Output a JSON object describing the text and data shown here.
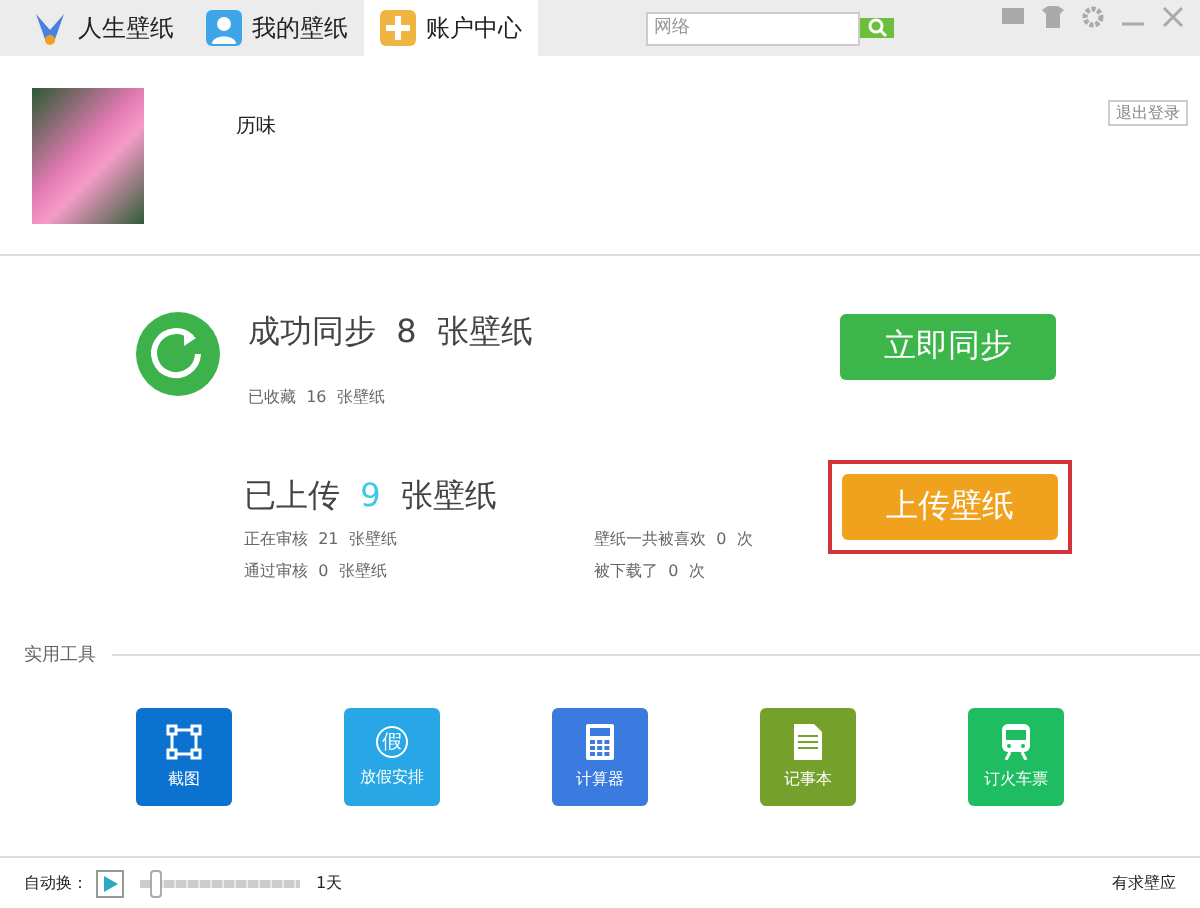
{
  "tabs": [
    {
      "label": "人生壁纸",
      "selected": false
    },
    {
      "label": "我的壁纸",
      "selected": false
    },
    {
      "label": "账户中心",
      "selected": true
    }
  ],
  "search": {
    "placeholder": "网络"
  },
  "profile": {
    "name": "历味",
    "logout": "退出登录"
  },
  "sync": {
    "title": "成功同步",
    "count": "8",
    "unit": "张壁纸",
    "sub_label": "已收藏",
    "sub_count": "16",
    "sub_unit": "张壁纸",
    "button": "立即同步"
  },
  "upload": {
    "title": "已上传",
    "count": "9",
    "unit": "张壁纸",
    "button": "上传壁纸",
    "highlighted": true,
    "stats": [
      {
        "label": "正在审核",
        "value": "21",
        "unit": "张壁纸"
      },
      {
        "label": "壁纸一共被喜欢",
        "value": "0",
        "unit": "次"
      },
      {
        "label": "通过审核",
        "value": "0",
        "unit": "张壁纸"
      },
      {
        "label": "被下载了",
        "value": "0",
        "unit": "次"
      }
    ]
  },
  "tools": {
    "heading": "实用工具",
    "items": [
      {
        "label": "截图",
        "kind": "crop",
        "color": "#0b72d0"
      },
      {
        "label": "放假安排",
        "kind": "glyph",
        "glyph": "假",
        "color": "#29a6e6"
      },
      {
        "label": "计算器",
        "kind": "calculator",
        "color": "#3b7be0"
      },
      {
        "label": "记事本",
        "kind": "note",
        "color": "#76a02c"
      },
      {
        "label": "订火车票",
        "kind": "train",
        "color": "#1ebd62"
      }
    ]
  },
  "footer": {
    "auto_label": "自动换：",
    "playing": false,
    "level": 0.1,
    "interval": "1天",
    "right_link": "有求壁应"
  }
}
